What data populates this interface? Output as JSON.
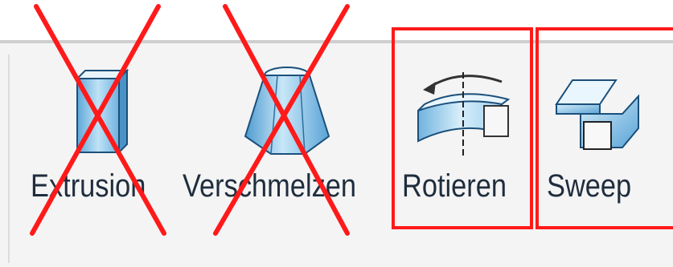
{
  "tools": [
    {
      "id": "extrusion",
      "label": "Extrusion",
      "icon": "extrusion-icon",
      "crossed_out": true
    },
    {
      "id": "verschmelzen",
      "label": "Verschmelzen",
      "icon": "loft-icon",
      "crossed_out": true
    },
    {
      "id": "rotieren",
      "label": "Rotieren",
      "icon": "revolve-icon",
      "highlighted": true
    },
    {
      "id": "sweep",
      "label": "Sweep",
      "icon": "sweep-icon",
      "highlighted": true
    }
  ],
  "colors": {
    "annotation_red": "#ff1a1a",
    "icon_blue": "#8cc6e8",
    "label_text": "#1f2d3d"
  }
}
